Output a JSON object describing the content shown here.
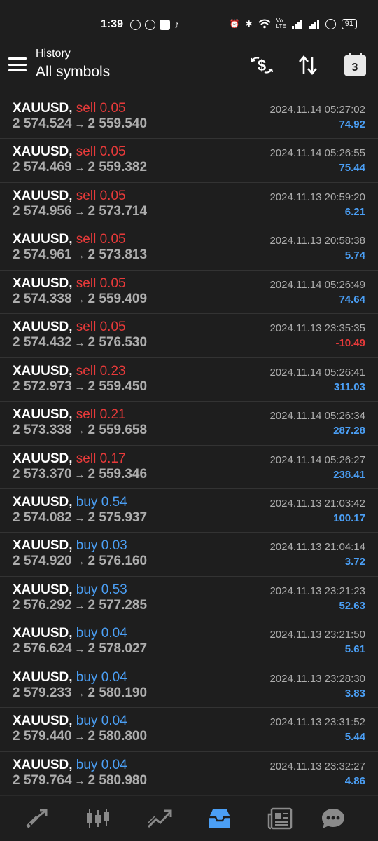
{
  "status_bar": {
    "time": "1:39",
    "battery": "91",
    "icons": [
      "alarm-icon",
      "bluetooth-icon",
      "wifi-icon",
      "volte-icon",
      "signal-icon",
      "signal-icon",
      "data-saver-icon"
    ]
  },
  "header": {
    "subtitle": "History",
    "title": "All symbols",
    "calendar_day": "3",
    "actions": [
      "currency-exchange-icon",
      "sort-icon",
      "calendar-icon"
    ]
  },
  "trades": [
    {
      "symbol": "XAUUSD,",
      "side": "sell",
      "volume": "0.05",
      "open": "2 574.524",
      "close": "2 559.540",
      "time": "2024.11.14 05:27:02",
      "profit": "74.92",
      "positive": true
    },
    {
      "symbol": "XAUUSD,",
      "side": "sell",
      "volume": "0.05",
      "open": "2 574.469",
      "close": "2 559.382",
      "time": "2024.11.14 05:26:55",
      "profit": "75.44",
      "positive": true
    },
    {
      "symbol": "XAUUSD,",
      "side": "sell",
      "volume": "0.05",
      "open": "2 574.956",
      "close": "2 573.714",
      "time": "2024.11.13 20:59:20",
      "profit": "6.21",
      "positive": true
    },
    {
      "symbol": "XAUUSD,",
      "side": "sell",
      "volume": "0.05",
      "open": "2 574.961",
      "close": "2 573.813",
      "time": "2024.11.13 20:58:38",
      "profit": "5.74",
      "positive": true
    },
    {
      "symbol": "XAUUSD,",
      "side": "sell",
      "volume": "0.05",
      "open": "2 574.338",
      "close": "2 559.409",
      "time": "2024.11.14 05:26:49",
      "profit": "74.64",
      "positive": true
    },
    {
      "symbol": "XAUUSD,",
      "side": "sell",
      "volume": "0.05",
      "open": "2 574.432",
      "close": "2 576.530",
      "time": "2024.11.13 23:35:35",
      "profit": "-10.49",
      "positive": false
    },
    {
      "symbol": "XAUUSD,",
      "side": "sell",
      "volume": "0.23",
      "open": "2 572.973",
      "close": "2 559.450",
      "time": "2024.11.14 05:26:41",
      "profit": "311.03",
      "positive": true
    },
    {
      "symbol": "XAUUSD,",
      "side": "sell",
      "volume": "0.21",
      "open": "2 573.338",
      "close": "2 559.658",
      "time": "2024.11.14 05:26:34",
      "profit": "287.28",
      "positive": true
    },
    {
      "symbol": "XAUUSD,",
      "side": "sell",
      "volume": "0.17",
      "open": "2 573.370",
      "close": "2 559.346",
      "time": "2024.11.14 05:26:27",
      "profit": "238.41",
      "positive": true
    },
    {
      "symbol": "XAUUSD,",
      "side": "buy",
      "volume": "0.54",
      "open": "2 574.082",
      "close": "2 575.937",
      "time": "2024.11.13 21:03:42",
      "profit": "100.17",
      "positive": true
    },
    {
      "symbol": "XAUUSD,",
      "side": "buy",
      "volume": "0.03",
      "open": "2 574.920",
      "close": "2 576.160",
      "time": "2024.11.13 21:04:14",
      "profit": "3.72",
      "positive": true
    },
    {
      "symbol": "XAUUSD,",
      "side": "buy",
      "volume": "0.53",
      "open": "2 576.292",
      "close": "2 577.285",
      "time": "2024.11.13 23:21:23",
      "profit": "52.63",
      "positive": true
    },
    {
      "symbol": "XAUUSD,",
      "side": "buy",
      "volume": "0.04",
      "open": "2 576.624",
      "close": "2 578.027",
      "time": "2024.11.13 23:21:50",
      "profit": "5.61",
      "positive": true
    },
    {
      "symbol": "XAUUSD,",
      "side": "buy",
      "volume": "0.04",
      "open": "2 579.233",
      "close": "2 580.190",
      "time": "2024.11.13 23:28:30",
      "profit": "3.83",
      "positive": true
    },
    {
      "symbol": "XAUUSD,",
      "side": "buy",
      "volume": "0.04",
      "open": "2 579.440",
      "close": "2 580.800",
      "time": "2024.11.13 23:31:52",
      "profit": "5.44",
      "positive": true
    },
    {
      "symbol": "XAUUSD,",
      "side": "buy",
      "volume": "0.04",
      "open": "2 579.764",
      "close": "2 580.980",
      "time": "2024.11.13 23:32:27",
      "profit": "4.86",
      "positive": true
    }
  ],
  "bottom_nav": {
    "items": [
      "quotes-icon",
      "chart-icon",
      "trade-icon",
      "history-icon",
      "news-icon",
      "messages-icon"
    ],
    "active_index": 3,
    "active_color": "#4b9ff5",
    "inactive_color": "#8a8a8a"
  },
  "colors": {
    "sell": "#e83a3a",
    "buy": "#4b9ff5",
    "profit_positive": "#4b9ff5",
    "profit_negative": "#e83a3a"
  }
}
